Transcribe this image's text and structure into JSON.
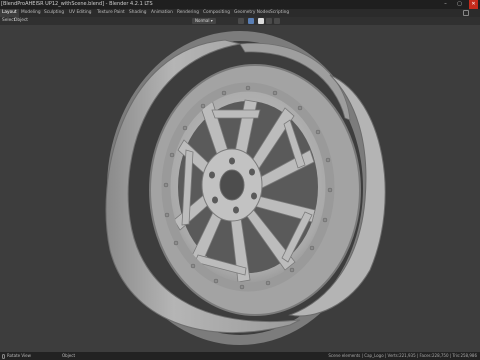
{
  "window": {
    "title": "[BlendProAHEISR UP12_withScene.blend] - Blender 4.2.1 LTS"
  },
  "workspaces": [
    "Layout",
    "Modeling",
    "Sculpting",
    "UV Editing",
    "Texture Paint",
    "Shading",
    "Animation",
    "Rendering",
    "Compositing",
    "Geometry Nodes",
    "Scripting"
  ],
  "active_workspace": "Layout",
  "header": {
    "menu": [
      "Select",
      "Object"
    ],
    "shading_mode": "Normal"
  },
  "status": {
    "left": "Rotate View",
    "center": "Object",
    "right": "Scene elements | Cap_Logo | Verts:221,935 | Faces:228,750 | Tris:258,986"
  },
  "colors": {
    "viewport_bg": "#3d3d3d",
    "accent": "#5a7fb5",
    "model": "#b8b8b8"
  },
  "icons": [
    "blender-logo-icon",
    "minimize-icon",
    "maximize-icon",
    "close-icon",
    "workspace-icon",
    "mouse-icon"
  ]
}
